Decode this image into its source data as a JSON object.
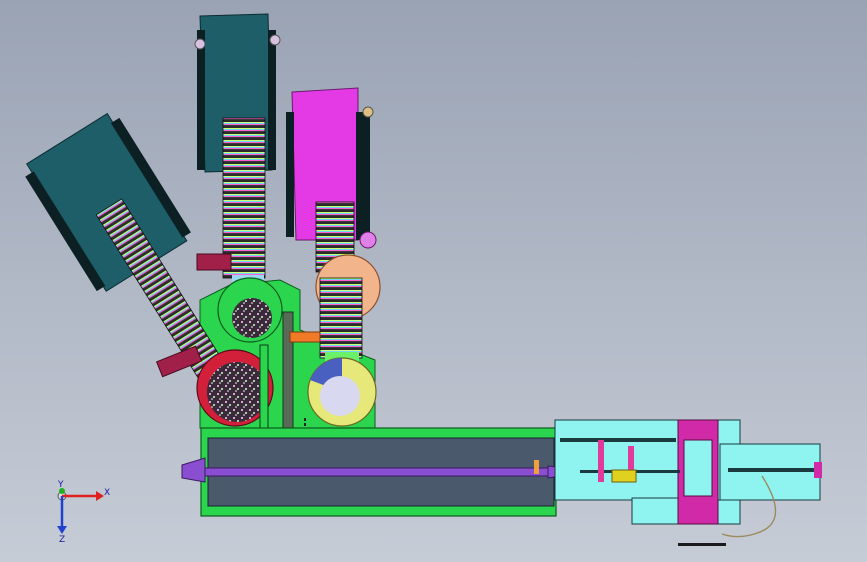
{
  "viewport": {
    "background_top": "#9aa3b4",
    "background_bottom": "#c6ccd6"
  },
  "triad": {
    "x_label": "X",
    "y_label": "Y",
    "z_label": "Z",
    "x_color": "#e02020",
    "y_color": "#20b020",
    "z_color": "#2040d0"
  },
  "colors": {
    "hopper_teal": "#1e5e68",
    "hopper_magenta": "#e33ae6",
    "base_green": "#2bd64e",
    "barrel_slate": "#4a5a6c",
    "frame_cyan": "#8ff3f0",
    "funnel_purple": "#8a4fd0",
    "bowl_red": "#d21f3a",
    "disc_peach": "#f2b48a",
    "maroon_part": "#a0204a"
  }
}
